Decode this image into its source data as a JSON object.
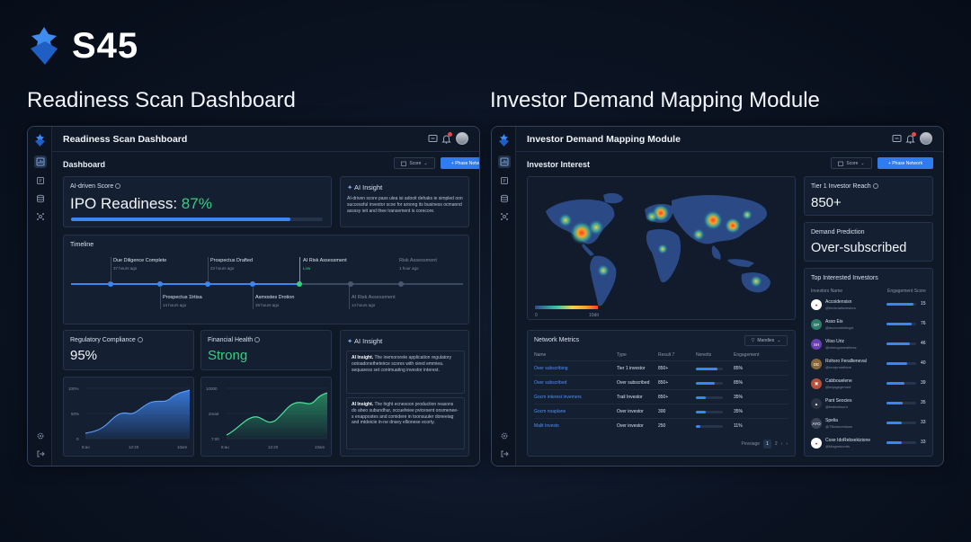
{
  "brand": {
    "name": "S45"
  },
  "sections": {
    "left_title": "Readiness Scan Dashboard",
    "right_title": "Investor Demand Mapping Module"
  },
  "left": {
    "app_title": "Readiness Scan Dashboard",
    "header": "Dashboard",
    "score_btn": "Score",
    "primary_btn": "+ Phase Network",
    "notification_count": "3",
    "ai_score": {
      "label": "AI-driven Score",
      "prefix": "IPO Readiness: ",
      "value": "87%",
      "progress": 0.87
    },
    "ai_insight_top": {
      "title": "AI Insight",
      "text": "AI-driven score pass ulea isi adooit dehaks ie simpled oon successful investor scoe for aroong its business ocmannd assssy ieit and thee transement is corecore."
    },
    "timeline": {
      "title": "Timeline",
      "top_items": [
        {
          "title": "Due Diligence Complete",
          "sub": "37 hours ago"
        },
        {
          "title": "Prospectus Drafted",
          "sub": "22 hours ago"
        },
        {
          "title": "AI Risk Assessment",
          "sub": "Low"
        },
        {
          "title": "Risk Assessment",
          "sub": "1 hour ago"
        }
      ],
      "bottom_items": [
        {
          "title": "Prospectus 1lrtisa",
          "sub": "14 hours ago"
        },
        {
          "title": "Asmostes Drotion",
          "sub": "28 hours ago"
        },
        {
          "title": "AI Risk Assessment",
          "sub": "14 hours ago"
        }
      ]
    },
    "regulatory": {
      "label": "Regulatory Compliance",
      "value": "95%"
    },
    "financial": {
      "label": "Financial Health",
      "value": "Strong"
    },
    "ai_insight_bottom": {
      "title": "AI Insight",
      "blocks": [
        {
          "bold": "AI Insight.",
          "text": " The inemororete application regulatory ootoadonetheteirce scores with oired emmiea. sequaress set contmuating investor interest."
        },
        {
          "bold": "AI Insight.",
          "text": " The hight ecnesoon production reasons do aheo subundhur, occuefeiee pvicesent onsmenee-s enappostes and comidere in toonsuuler doneeiag and mtdeicie in-ne dnsey ellionese ecorty."
        }
      ]
    },
    "chart1": {
      "yticks": [
        "100%",
        "50%",
        "0"
      ],
      "xticks": [
        "8:ao",
        "12:20",
        "10am"
      ]
    },
    "chart2": {
      "yticks": [
        "10000",
        "2ma0",
        "7:00"
      ],
      "xticks": [
        "8:au",
        "12:20",
        "10am"
      ]
    }
  },
  "right": {
    "app_title": "Investor Demand Mapping Module",
    "header": "Investor Interest",
    "score_btn": "Score",
    "primary_btn": "+ Phase Network",
    "notification_count": "3",
    "map_legend": {
      "min": "0",
      "max": "10dit"
    },
    "tier1": {
      "label": "Tier 1 Investor Reach",
      "value": "850+"
    },
    "demand": {
      "label": "Demand Prediction",
      "value": "Over-subscribed"
    },
    "network": {
      "title": "Network Metrics",
      "filter": "Mandies",
      "columns": [
        "Name",
        "Type",
        "Result 7",
        "Nenetts",
        "Engagement"
      ],
      "rows": [
        {
          "name": "Over subscribing",
          "type": "Tier 1 investor",
          "result": "850+",
          "bar": 0.8,
          "eng": "85%"
        },
        {
          "name": "Over subscribed",
          "type": "Over subscribed",
          "result": "850+",
          "bar": 0.7,
          "eng": "85%"
        },
        {
          "name": "Gocm interest invemers",
          "type": "Trail Investor",
          "result": "850+",
          "bar": 0.35,
          "eng": "35%"
        },
        {
          "name": "Gocm noaplane",
          "type": "Over investor",
          "result": "300",
          "bar": 0.35,
          "eng": "35%"
        },
        {
          "name": "Malit Invests",
          "type": "Over investor",
          "result": "250",
          "bar": 0.15,
          "eng": "11%"
        }
      ],
      "pagination": {
        "label": "Pevsiage",
        "pages": [
          "1",
          "2",
          "›",
          "›"
        ]
      }
    },
    "investors": {
      "title": "Top Interested Investors",
      "col1": "Investors Name",
      "col2": "Engagement Score",
      "rows": [
        {
          "initials": "●",
          "name": "Accoidensisn",
          "sub": "@hecknalinvestors",
          "score": "15",
          "fill": 0.92,
          "color": "#ffffff"
        },
        {
          "initials": "GP",
          "name": "Asso Eis",
          "sub": "@acocounintegot",
          "score": "76",
          "fill": 0.85,
          "color": "#2e7d6b"
        },
        {
          "initials": "SH",
          "name": "Viiso Uriz",
          "sub": "@cinecgnwealhess",
          "score": "46",
          "fill": 0.8,
          "color": "#6b3fb5"
        },
        {
          "initials": "DE",
          "name": "Rohsro Ferallieneval",
          "sub": "@reorprrsetbioe",
          "score": "40",
          "fill": 0.7,
          "color": "#8a6a3a"
        },
        {
          "initials": "▣",
          "name": "Cabbouelene",
          "sub": "@enjagegemed",
          "score": "39",
          "fill": 0.62,
          "color": "#b8503a"
        },
        {
          "initials": "▲",
          "name": "Pant Seocies",
          "sub": "@testbohsorn",
          "score": "35",
          "fill": 0.55,
          "color": "#2a3344"
        },
        {
          "initials": "AYO",
          "name": "Spelia",
          "sub": "@TBciseomlows",
          "score": "33",
          "fill": 0.5,
          "color": "#3a4456"
        },
        {
          "initials": "●",
          "name": "Coxe IdoRebsekizione",
          "sub": "@Magnesomts",
          "score": "33",
          "fill": 0.5,
          "color": "#ffffff"
        }
      ]
    }
  }
}
